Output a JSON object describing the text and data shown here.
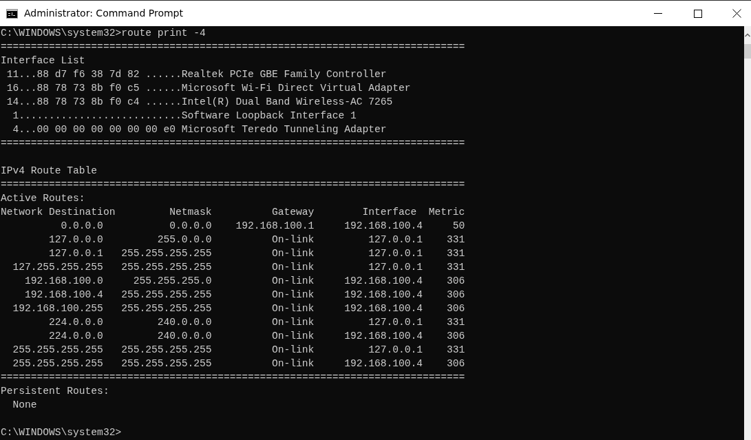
{
  "window": {
    "title": "Administrator: Command Prompt"
  },
  "console": {
    "blocks": [
      {
        "kind": "line",
        "text": "C:\\WINDOWS\\system32>route print -4"
      },
      {
        "kind": "line",
        "text": "============================================================================="
      },
      {
        "kind": "line",
        "text": "Interface List"
      },
      {
        "kind": "line",
        "text": " 11...88 d7 f6 38 7d 82 ......Realtek PCIe GBE Family Controller"
      },
      {
        "kind": "line",
        "text": " 16...88 78 73 8b f0 c5 ......Microsoft Wi-Fi Direct Virtual Adapter"
      },
      {
        "kind": "line",
        "text": " 14...88 78 73 8b f0 c4 ......Intel(R) Dual Band Wireless-AC 7265"
      },
      {
        "kind": "line",
        "text": "  1...........................Software Loopback Interface 1"
      },
      {
        "kind": "line",
        "text": "  4...00 00 00 00 00 00 00 e0 Microsoft Teredo Tunneling Adapter"
      },
      {
        "kind": "line",
        "text": "============================================================================="
      },
      {
        "kind": "blank"
      },
      {
        "kind": "line",
        "text": "IPv4 Route Table"
      },
      {
        "kind": "line",
        "text": "============================================================================="
      },
      {
        "kind": "line",
        "text": "Active Routes:"
      },
      {
        "kind": "routes",
        "header": [
          "Network Destination",
          "Netmask",
          "Gateway",
          "Interface",
          "Metric"
        ],
        "rows": [
          [
            "0.0.0.0",
            "0.0.0.0",
            "192.168.100.1",
            "192.168.100.4",
            "50"
          ],
          [
            "127.0.0.0",
            "255.0.0.0",
            "On-link",
            "127.0.0.1",
            "331"
          ],
          [
            "127.0.0.1",
            "255.255.255.255",
            "On-link",
            "127.0.0.1",
            "331"
          ],
          [
            "127.255.255.255",
            "255.255.255.255",
            "On-link",
            "127.0.0.1",
            "331"
          ],
          [
            "192.168.100.0",
            "255.255.255.0",
            "On-link",
            "192.168.100.4",
            "306"
          ],
          [
            "192.168.100.4",
            "255.255.255.255",
            "On-link",
            "192.168.100.4",
            "306"
          ],
          [
            "192.168.100.255",
            "255.255.255.255",
            "On-link",
            "192.168.100.4",
            "306"
          ],
          [
            "224.0.0.0",
            "240.0.0.0",
            "On-link",
            "127.0.0.1",
            "331"
          ],
          [
            "224.0.0.0",
            "240.0.0.0",
            "On-link",
            "192.168.100.4",
            "306"
          ],
          [
            "255.255.255.255",
            "255.255.255.255",
            "On-link",
            "127.0.0.1",
            "331"
          ],
          [
            "255.255.255.255",
            "255.255.255.255",
            "On-link",
            "192.168.100.4",
            "306"
          ]
        ]
      },
      {
        "kind": "line",
        "text": "============================================================================="
      },
      {
        "kind": "line",
        "text": "Persistent Routes:"
      },
      {
        "kind": "line",
        "text": "  None"
      },
      {
        "kind": "blank"
      },
      {
        "kind": "line",
        "text": "C:\\WINDOWS\\system32>"
      }
    ]
  }
}
